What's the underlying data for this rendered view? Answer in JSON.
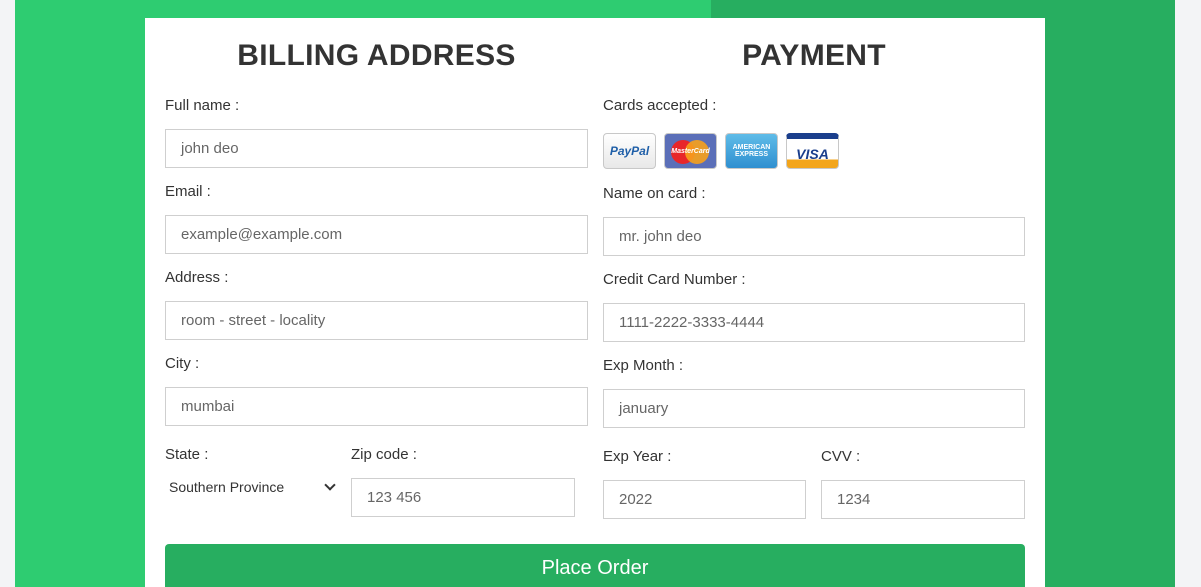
{
  "billing": {
    "title": "BILLING ADDRESS",
    "full_name_label": "Full name :",
    "full_name_placeholder": "john deo",
    "email_label": "Email :",
    "email_placeholder": "example@example.com",
    "address_label": "Address :",
    "address_placeholder": "room - street - locality",
    "city_label": "City :",
    "city_placeholder": "mumbai",
    "state_label": "State :",
    "state_value": "Southern Province",
    "zip_label": "Zip code :",
    "zip_placeholder": "123 456"
  },
  "payment": {
    "title": "PAYMENT",
    "cards_label": "Cards accepted :",
    "cards": [
      "PayPal",
      "MasterCard",
      "AMERICAN EXPRESS",
      "VISA"
    ],
    "name_label": "Name on card :",
    "name_placeholder": "mr. john deo",
    "number_label": "Credit Card Number :",
    "number_placeholder": "1111-2222-3333-4444",
    "exp_month_label": "Exp Month :",
    "exp_month_placeholder": "january",
    "exp_year_label": "Exp Year :",
    "exp_year_placeholder": "2022",
    "cvv_label": "CVV :",
    "cvv_placeholder": "1234"
  },
  "submit_label": "Place Order",
  "colors": {
    "background_green": "#2ecc71",
    "background_green_dark": "#27ae60",
    "button": "#27ae60"
  }
}
